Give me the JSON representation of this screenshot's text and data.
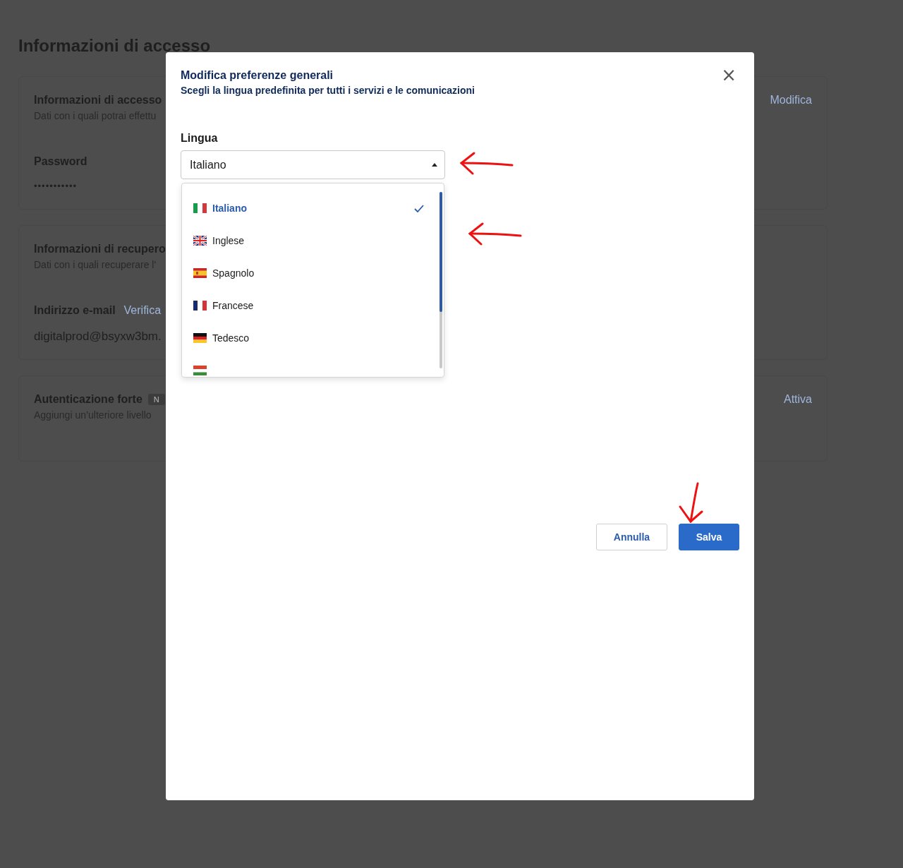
{
  "page": {
    "title": "Informazioni di accesso",
    "cards": [
      {
        "title": "Informazioni di accesso",
        "description": "Dati con i quali potrai effettu",
        "action": "Modifica",
        "fields": [
          {
            "label": "Password",
            "value": "•••••••••••",
            "kind": "secret"
          }
        ]
      },
      {
        "title": "Informazioni di recupero",
        "description": "Dati con i quali recuperare l'",
        "fields": [
          {
            "label": "Indirizzo e-mail",
            "link": "Verifica",
            "value": "digitalprod@bsyxw3bm.",
            "kind": "text"
          }
        ]
      },
      {
        "title": "Autenticazione forte",
        "badge": "N",
        "description": "Aggiungi un’ulteriore livello",
        "action": "Attiva"
      }
    ]
  },
  "dialog": {
    "title": "Modifica preferenze generali",
    "subtitle": "Scegli la lingua predefinita per tutti i servizi e le comunicazioni",
    "close": "×",
    "field_label": "Lingua",
    "select": {
      "value": "Italiano",
      "expanded": true
    },
    "options": [
      {
        "label": "Italiano",
        "kind": "it",
        "selected": true
      },
      {
        "label": "Inglese",
        "kind": "gb",
        "selected": false
      },
      {
        "label": "Spagnolo",
        "kind": "es",
        "selected": false
      },
      {
        "label": "Francese",
        "kind": "fr",
        "selected": false
      },
      {
        "label": "Tedesco",
        "kind": "de",
        "selected": false
      },
      {
        "kind": "hu",
        "selected": false
      }
    ],
    "buttons": [
      {
        "label": "Annulla",
        "kind": "secondary"
      },
      {
        "label": "Salva",
        "kind": "primary"
      }
    ]
  },
  "annotations": [
    {
      "kind": "left"
    },
    {
      "kind": "left"
    },
    {
      "kind": "down"
    }
  ]
}
